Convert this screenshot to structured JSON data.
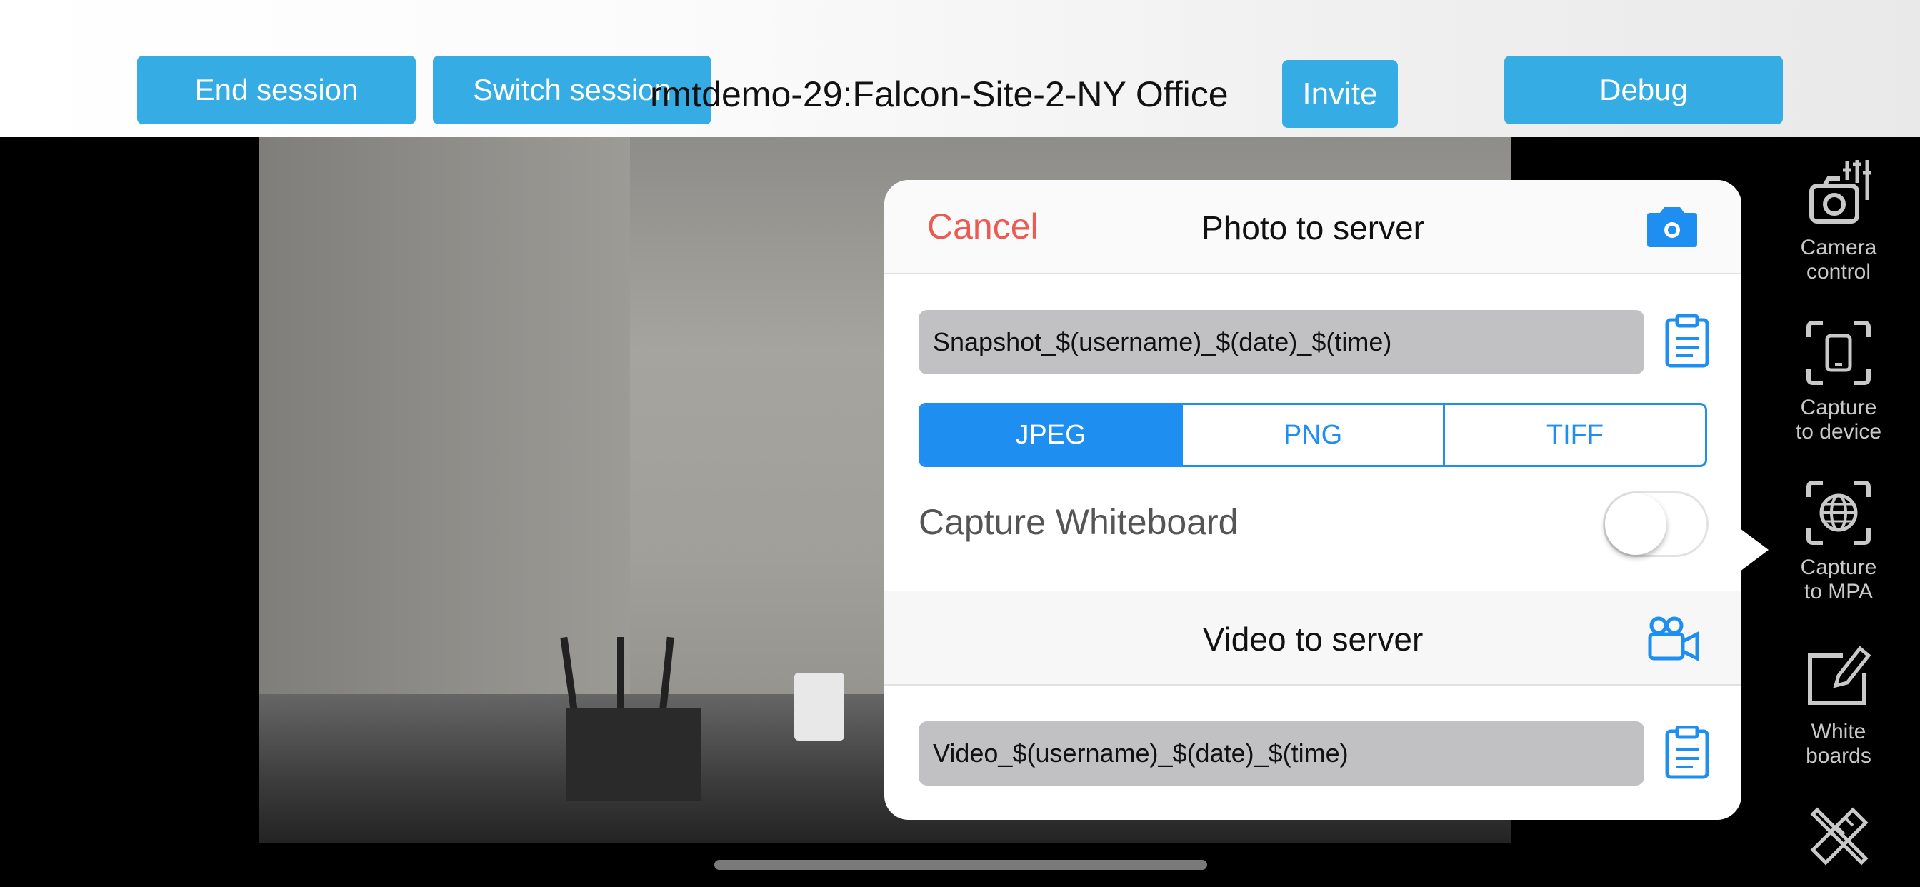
{
  "header": {
    "end_session": "End session",
    "switch_session": "Switch session",
    "session_title": "rmtdemo-29:Falcon-Site-2-NY Office",
    "invite": "Invite",
    "debug": "Debug"
  },
  "popover": {
    "cancel": "Cancel",
    "photo_title": "Photo to server",
    "photo_filename": "Snapshot_$(username)_$(date)_$(time)",
    "formats": [
      "JPEG",
      "PNG",
      "TIFF"
    ],
    "selected_format": "JPEG",
    "capture_whiteboard_label": "Capture Whiteboard",
    "capture_whiteboard_on": false,
    "video_title": "Video to server",
    "video_filename": "Video_$(username)_$(date)_$(time)"
  },
  "rail": {
    "items": [
      {
        "label_1": "Camera",
        "label_2": "control",
        "icon": "camera-control-icon"
      },
      {
        "label_1": "Capture",
        "label_2": "to device",
        "icon": "capture-device-icon"
      },
      {
        "label_1": "Capture",
        "label_2": "to MPA",
        "icon": "capture-mpa-icon"
      },
      {
        "label_1": "White",
        "label_2": "boards",
        "icon": "whiteboard-icon"
      },
      {
        "icon": "tools-icon"
      }
    ]
  },
  "colors": {
    "accent": "#35ace4",
    "segment_blue": "#1e8ff0",
    "cancel_red": "#ec5b53"
  }
}
